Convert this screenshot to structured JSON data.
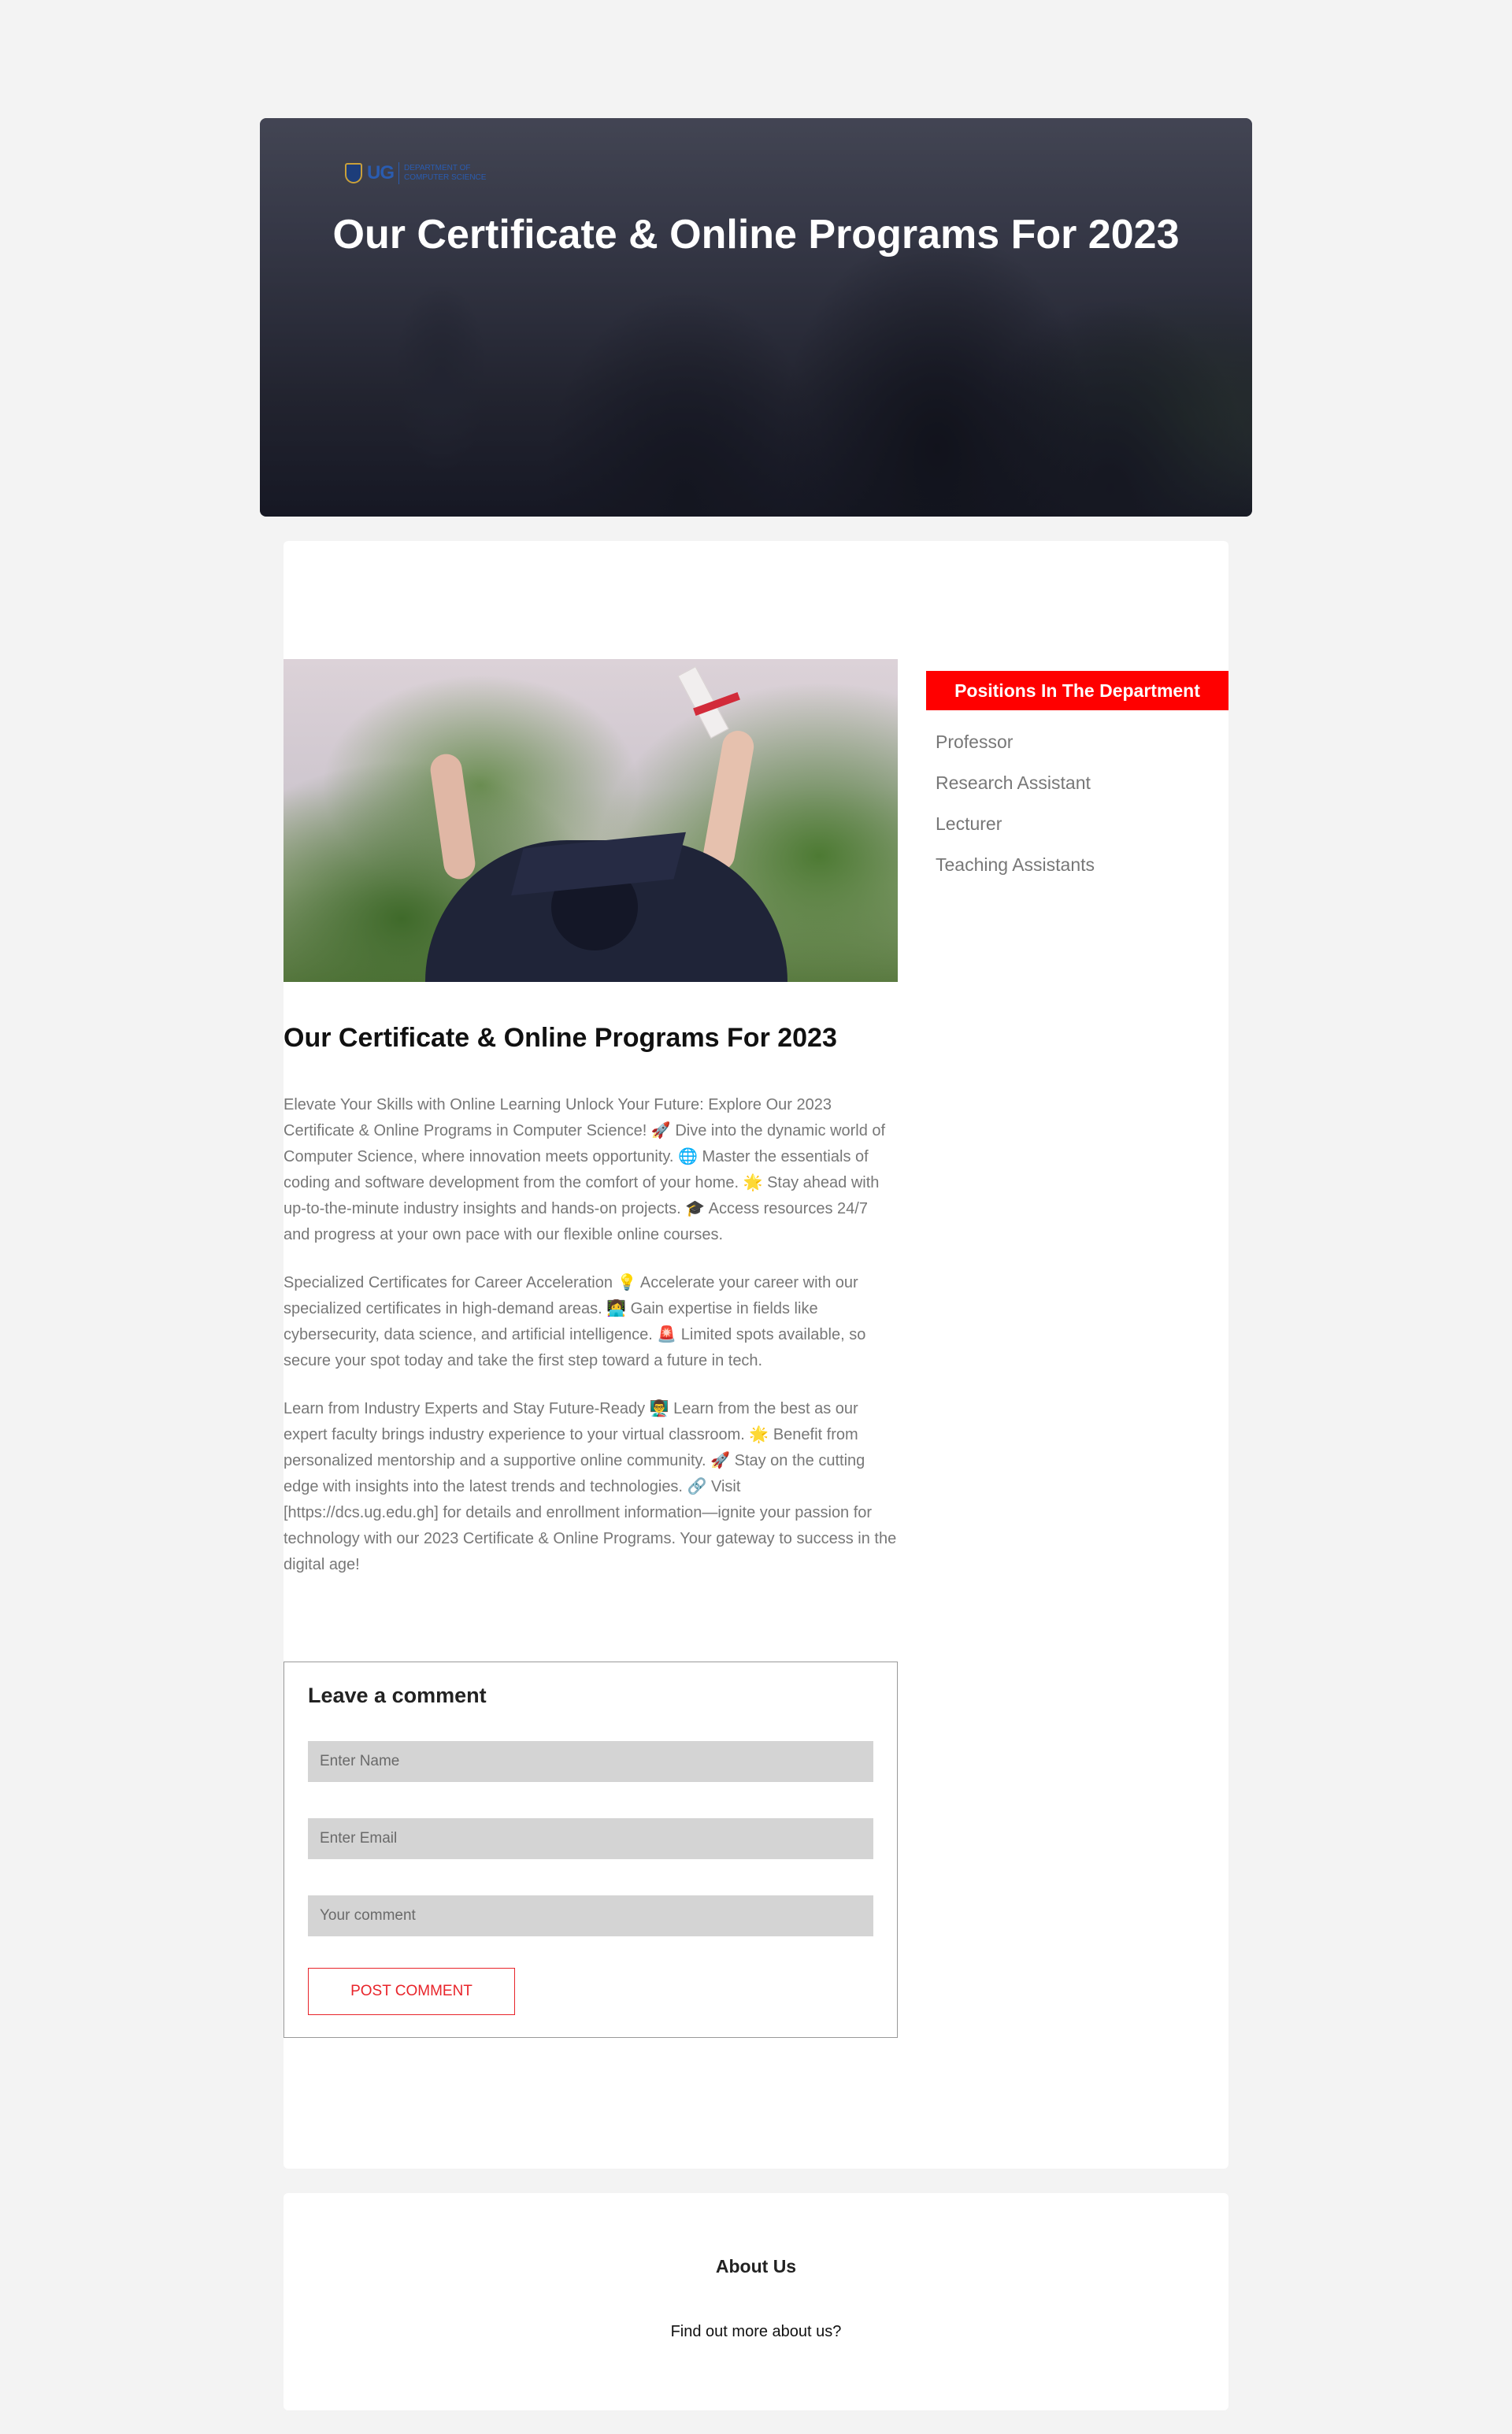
{
  "hero": {
    "logo_text": "UG",
    "logo_subtext": "DEPARTMENT OF COMPUTER SCIENCE",
    "title": "Our Certificate & Online Programs For 2023"
  },
  "post": {
    "title": "Our Certificate & Online Programs For 2023",
    "paragraphs": [
      "Elevate Your Skills with Online Learning Unlock Your Future: Explore Our 2023 Certificate & Online Programs in Computer Science! 🚀 Dive into the dynamic world of Computer Science, where innovation meets opportunity. 🌐 Master the essentials of coding and software development from the comfort of your home. 🌟 Stay ahead with up-to-the-minute industry insights and hands-on projects. 🎓 Access resources 24/7 and progress at your own pace with our flexible online courses.",
      "Specialized Certificates for Career Acceleration 💡 Accelerate your career with our specialized certificates in high-demand areas. 👩‍💻 Gain expertise in fields like cybersecurity, data science, and artificial intelligence. 🚨 Limited spots available, so secure your spot today and take the first step toward a future in tech.",
      "Learn from Industry Experts and Stay Future-Ready 👨‍🏫 Learn from the best as our expert faculty brings industry experience to your virtual classroom. 🌟 Benefit from personalized mentorship and a supportive online community. 🚀 Stay on the cutting edge with insights into the latest trends and technologies. 🔗 Visit [https://dcs.ug.edu.gh] for details and enrollment information—ignite your passion for technology with our 2023 Certificate & Online Programs. Your gateway to success in the digital age!"
    ]
  },
  "comment": {
    "title": "Leave a comment",
    "name_placeholder": "Enter Name",
    "email_placeholder": "Enter Email",
    "comment_placeholder": "Your comment",
    "submit_label": "POST COMMENT"
  },
  "sidebar": {
    "header": "Positions In The Department",
    "items": [
      "Professor",
      "Research Assistant",
      "Lecturer",
      "Teaching Assistants"
    ]
  },
  "about": {
    "title": "About Us",
    "link": "Find out more about us?"
  },
  "colors": {
    "accent": "#ff0000",
    "background": "#f3f3f3"
  }
}
